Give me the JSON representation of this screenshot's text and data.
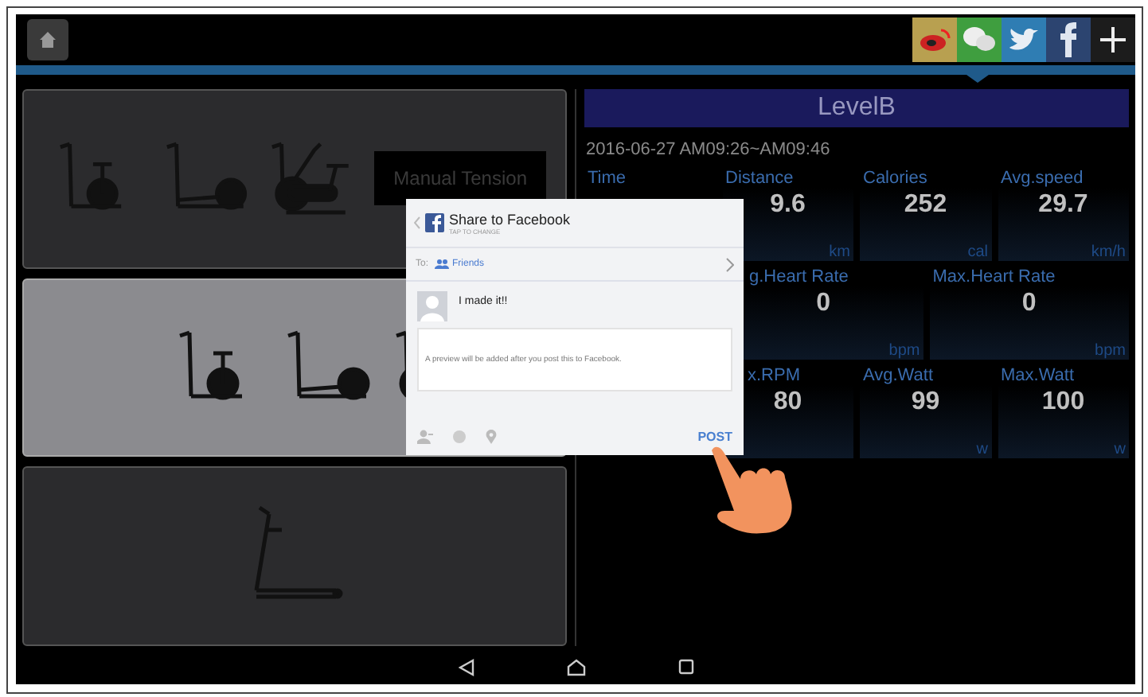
{
  "share_buttons": [
    {
      "kind": "weibo",
      "color": "#b8a050"
    },
    {
      "kind": "wechat",
      "color": "#3f9e3f"
    },
    {
      "kind": "twitter",
      "color": "#2f7db3"
    },
    {
      "kind": "facebook",
      "color": "#2c4470"
    },
    {
      "kind": "more",
      "color": "#1c1c1c"
    }
  ],
  "machines": [
    {
      "kind": "bikes",
      "selected": false,
      "label": "Manual Tension"
    },
    {
      "kind": "bikes",
      "selected": true
    },
    {
      "kind": "treadmill",
      "selected": false
    }
  ],
  "session": {
    "title": "LevelB",
    "time_range": "2016-06-27 AM09:26~AM09:46",
    "rows": [
      {
        "cells": [
          {
            "label": "Time"
          },
          {
            "label": "Distance",
            "value": "9.6",
            "unit": "km"
          },
          {
            "label": "Calories",
            "value": "252",
            "unit": "cal"
          },
          {
            "label": "Avg.speed",
            "value": "29.7",
            "unit": "km/h"
          }
        ]
      },
      {
        "cells": [
          {},
          {
            "label": "g.Heart Rate",
            "value": "0",
            "unit": "bpm"
          },
          {
            "label": "Max.Heart Rate",
            "value": "0",
            "unit": "bpm"
          }
        ]
      },
      {
        "cells": [
          {},
          {
            "label": "x.RPM",
            "value": "80"
          },
          {
            "label": "Avg.Watt",
            "value": "99",
            "unit": "w"
          },
          {
            "label": "Max.Watt",
            "value": "100",
            "unit": "w"
          }
        ]
      }
    ]
  },
  "share_dialog": {
    "title": "Share to Facebook",
    "subtitle": "TAP TO CHANGE",
    "to_label": "To:",
    "audience": "Friends",
    "message": "I made it!!",
    "preview_note": "A preview will be added after you post this to Facebook.",
    "post_button": "POST"
  }
}
